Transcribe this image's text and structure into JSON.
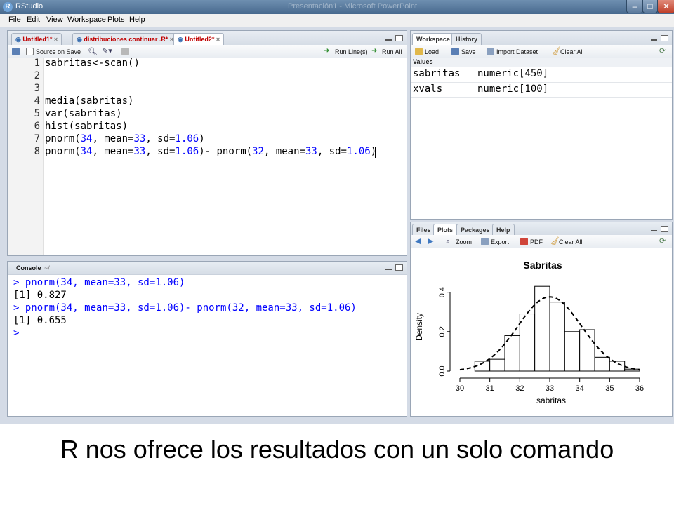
{
  "window": {
    "title": "RStudio",
    "background_title": "Presentación1 - Microsoft PowerPoint",
    "min_label": "–",
    "max_label": "□",
    "close_label": "✕"
  },
  "menu": [
    "File",
    "Edit",
    "View",
    "Workspace",
    "Plots",
    "Help"
  ],
  "source": {
    "tabs": [
      {
        "label": "Untitled1*"
      },
      {
        "label": "distribuciones continuar .R*"
      },
      {
        "label": "Untitled2*"
      }
    ],
    "source_on_save": "Source on Save",
    "run_lines": "Run Line(s)",
    "run_all": "Run All",
    "line_numbers": [
      "1",
      "2",
      "3",
      "4",
      "5",
      "6",
      "7",
      "8"
    ],
    "lines": [
      "sabritas<-scan()",
      "",
      "",
      "media(sabritas)",
      "var(sabritas)",
      "hist(sabritas)",
      "pnorm(34, mean=33, sd=1.06)",
      "pnorm(34, mean=33, sd=1.06)- pnorm(32, mean=33, sd=1.06)"
    ]
  },
  "console": {
    "title": "Console",
    "path": "~/",
    "lines": [
      {
        "text": "> pnorm(34, mean=33, sd=1.06)",
        "color": "#0000ff"
      },
      {
        "text": "[1] 0.827",
        "color": "#000000"
      },
      {
        "text": "> pnorm(34, mean=33, sd=1.06)- pnorm(32, mean=33, sd=1.06)",
        "color": "#0000ff"
      },
      {
        "text": "[1] 0.655",
        "color": "#000000"
      },
      {
        "text": ">",
        "color": "#0000ff"
      }
    ]
  },
  "workspace": {
    "tabs": [
      "Workspace",
      "History"
    ],
    "load": "Load",
    "save": "Save",
    "import_dataset": "Import Dataset",
    "clear_all": "Clear All",
    "section": "Values",
    "rows": [
      {
        "name": "sabritas",
        "value": "numeric[450]"
      },
      {
        "name": "xvals",
        "value": "numeric[100]"
      }
    ]
  },
  "plots_pane": {
    "tabs": [
      "Files",
      "Plots",
      "Packages",
      "Help"
    ],
    "zoom": "Zoom",
    "export": "Export",
    "pdf": "PDF",
    "clear_all": "Clear All"
  },
  "chart_data": {
    "type": "bar",
    "title": "Sabritas",
    "xlabel": "sabritas",
    "ylabel": "Density",
    "xlim": [
      30,
      36
    ],
    "ylim": [
      0,
      0.42
    ],
    "xticks": [
      "30",
      "31",
      "32",
      "33",
      "34",
      "35",
      "36"
    ],
    "yticks": [
      "0.0",
      "0.2",
      "0.4"
    ],
    "bin_width": 0.5,
    "bins": [
      {
        "x0": 30.0,
        "density": 0.0
      },
      {
        "x0": 30.5,
        "density": 0.05
      },
      {
        "x0": 31.0,
        "density": 0.06
      },
      {
        "x0": 31.5,
        "density": 0.18
      },
      {
        "x0": 32.0,
        "density": 0.29
      },
      {
        "x0": 32.5,
        "density": 0.43
      },
      {
        "x0": 33.0,
        "density": 0.35
      },
      {
        "x0": 33.5,
        "density": 0.2
      },
      {
        "x0": 34.0,
        "density": 0.21
      },
      {
        "x0": 34.5,
        "density": 0.07
      },
      {
        "x0": 35.0,
        "density": 0.05
      },
      {
        "x0": 35.5,
        "density": 0.01
      }
    ],
    "density_curve": {
      "style": "dashed",
      "mean": 33,
      "sd": 1.06
    }
  },
  "caption": "R nos ofrece los resultados con un solo comando"
}
